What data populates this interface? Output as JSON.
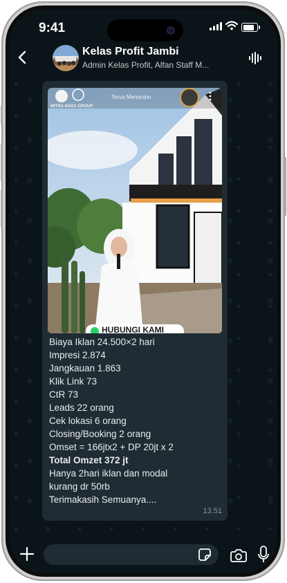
{
  "status_bar": {
    "time": "9:41"
  },
  "header": {
    "title": "Kelas Profit Jambi",
    "subtitle": "Admin Kelas Profit, Alfan Staff M..."
  },
  "message": {
    "video_overlay": {
      "logo_text": "MITRA NADA GROUP",
      "caption": "Terus Menonton",
      "banner": "HUBUNGI KAMI"
    },
    "lines": [
      "Biaya Iklan 24.500×2 hari",
      "Impresi 2.874",
      "Jangkauan 1.863",
      "Klik Link 73",
      "CtR 73",
      "Leads 22 orang",
      "Cek lokasi 6 orang",
      "Closing/Booking 2 orang",
      "Omset = 166jtx2 + DP 20jt x 2"
    ],
    "bold_line": "Total Omzet 372 jt",
    "tail_lines": [
      "Hanya 2hari iklan dan modal",
      "kurang dr 50rb",
      "Terimakasih Semuanya...."
    ],
    "timestamp": "13.51"
  },
  "colors": {
    "chat_bg": "#0b1419",
    "bubble": "#1f2c33",
    "text": "#e9edef",
    "meta": "#8696a0"
  }
}
